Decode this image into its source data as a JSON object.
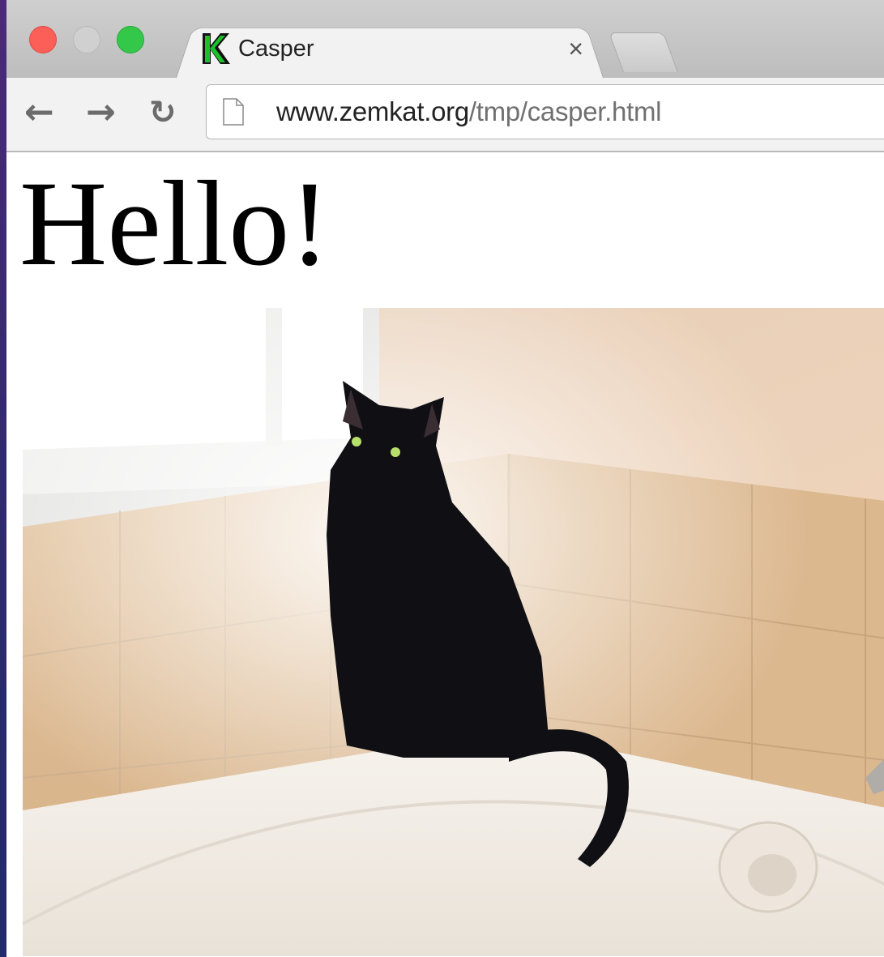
{
  "browser": {
    "tab": {
      "title": "Casper",
      "close_symbol": "×",
      "favicon": "k-favicon"
    },
    "nav": {
      "back_symbol": "←",
      "forward_symbol": "→",
      "reload_symbol": "↻"
    },
    "address": {
      "domain": "www.zemkat.org",
      "path": "/tmp/casper.html"
    },
    "traffic_lights": {
      "close_color": "#fc5f57",
      "minimize_color": "#d0d0d0",
      "maximize_color": "#34c84a"
    }
  },
  "page": {
    "heading": "Hello!",
    "image": {
      "subject": "black-cat-on-bathtub",
      "alt": ""
    }
  }
}
